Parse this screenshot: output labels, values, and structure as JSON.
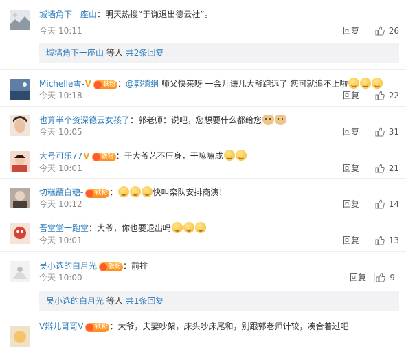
{
  "comments": [
    {
      "user": "城墙角下一座山",
      "verified": "",
      "badge": "",
      "colon": "：",
      "mention": "",
      "text": "明天热搜“于谦退出德云社”。",
      "emojis": [],
      "date": "今天",
      "time": "10:11",
      "reply": "回复",
      "likes": "26",
      "avatar_bg": "#dfe3e8",
      "thread": {
        "user": "城墙角下一座山",
        "middle": "等人",
        "count_text": "共2条回复"
      }
    },
    {
      "user": "Michelle雪-",
      "verified": "V",
      "badge": "铁粉",
      "colon": "：",
      "mention": "@郭德纲",
      "text": " 师父快来呀 一会儿谦儿大爷跑远了 您可就追不上啦",
      "emojis": [
        "smile",
        "smile",
        "smile"
      ],
      "date": "今天",
      "time": "10:18",
      "reply": "回复",
      "likes": "22",
      "avatar_bg": "#5c7fa8"
    },
    {
      "user": "也算半个资深德云女孩了",
      "verified": "",
      "badge": "",
      "colon": "：",
      "mention": "",
      "text": "郭老师：说吧，您想要什么都给您",
      "emojis": [
        "cat",
        "cat"
      ],
      "date": "今天",
      "time": "10:05",
      "reply": "回复",
      "likes": "31",
      "avatar_bg": "#e9c9b7"
    },
    {
      "user": "大号可乐77",
      "verified": "V",
      "badge": "铁粉",
      "colon": "：",
      "mention": "",
      "text": "于大爷艺不压身，干嘛嘛成",
      "emojis": [
        "smile",
        "smile"
      ],
      "date": "今天",
      "time": "10:01",
      "reply": "回复",
      "likes": "21",
      "avatar_bg": "#c94a3a"
    },
    {
      "user": "切糕蘸白糖-",
      "verified": "",
      "badge": "铁粉",
      "colon": "：",
      "mention": "",
      "text": "快叫栾队安排商演！",
      "emojis_before": [
        "smile",
        "smile",
        "smile"
      ],
      "emojis": [],
      "date": "今天",
      "time": "10:12",
      "reply": "回复",
      "likes": "14",
      "avatar_bg": "#7d6e62"
    },
    {
      "user": "吾堂堂一跑堂",
      "verified": "",
      "badge": "",
      "colon": "：",
      "mention": "",
      "text": "大爷，你也要退出吗",
      "emojis": [
        "smile",
        "smile",
        "smile"
      ],
      "date": "今天",
      "time": "10:01",
      "reply": "回复",
      "likes": "13",
      "avatar_bg": "#d64236"
    },
    {
      "user": "吴小选的白月光",
      "verified": "",
      "badge": "铁粉",
      "colon": "：",
      "mention": "",
      "text": "前排",
      "emojis": [],
      "date": "今天",
      "time": "10:00",
      "reply": "回复",
      "likes": "9",
      "avatar_bg": "#e9e9e9",
      "thread": {
        "user": "吴小选的白月光",
        "middle": "等人",
        "count_text": "共1条回复"
      }
    },
    {
      "user": "V辩儿哥哥V",
      "verified": "",
      "badge": "铁粉",
      "colon": "：",
      "mention": "",
      "text": "大爷，夫妻吵架，床头吵床尾和，别跟郭老师计较，凑合着过吧",
      "emojis": [],
      "date": "",
      "time": "",
      "reply": "",
      "likes": "",
      "avatar_bg": "#efe2c9"
    }
  ]
}
